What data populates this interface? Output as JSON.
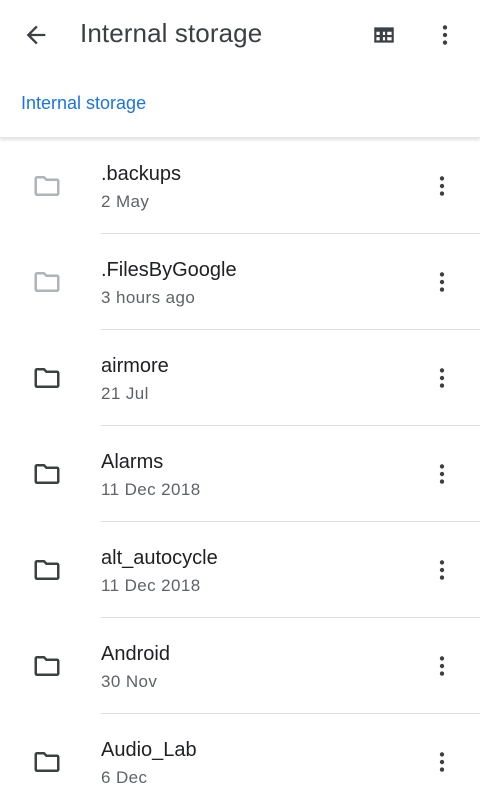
{
  "header": {
    "title": "Internal storage",
    "icons": {
      "back": "arrow-back-icon",
      "grid": "grid-view-icon",
      "more": "more-vert-icon"
    }
  },
  "breadcrumb": {
    "label": "Internal storage"
  },
  "colors": {
    "accent": "#1a73e8",
    "folder_dark": "#3c4043",
    "folder_hidden": "#b0b3b8",
    "secondary_text": "#5f6368",
    "divider": "#dadce0"
  },
  "folders": [
    {
      "name": ".backups",
      "date": "2 May",
      "hidden": true
    },
    {
      "name": ".FilesByGoogle",
      "date": "3 hours ago",
      "hidden": true
    },
    {
      "name": "airmore",
      "date": "21 Jul",
      "hidden": false
    },
    {
      "name": "Alarms",
      "date": "11 Dec 2018",
      "hidden": false
    },
    {
      "name": "alt_autocycle",
      "date": "11 Dec 2018",
      "hidden": false
    },
    {
      "name": "Android",
      "date": "30 Nov",
      "hidden": false
    },
    {
      "name": "Audio_Lab",
      "date": "6 Dec",
      "hidden": false
    }
  ]
}
